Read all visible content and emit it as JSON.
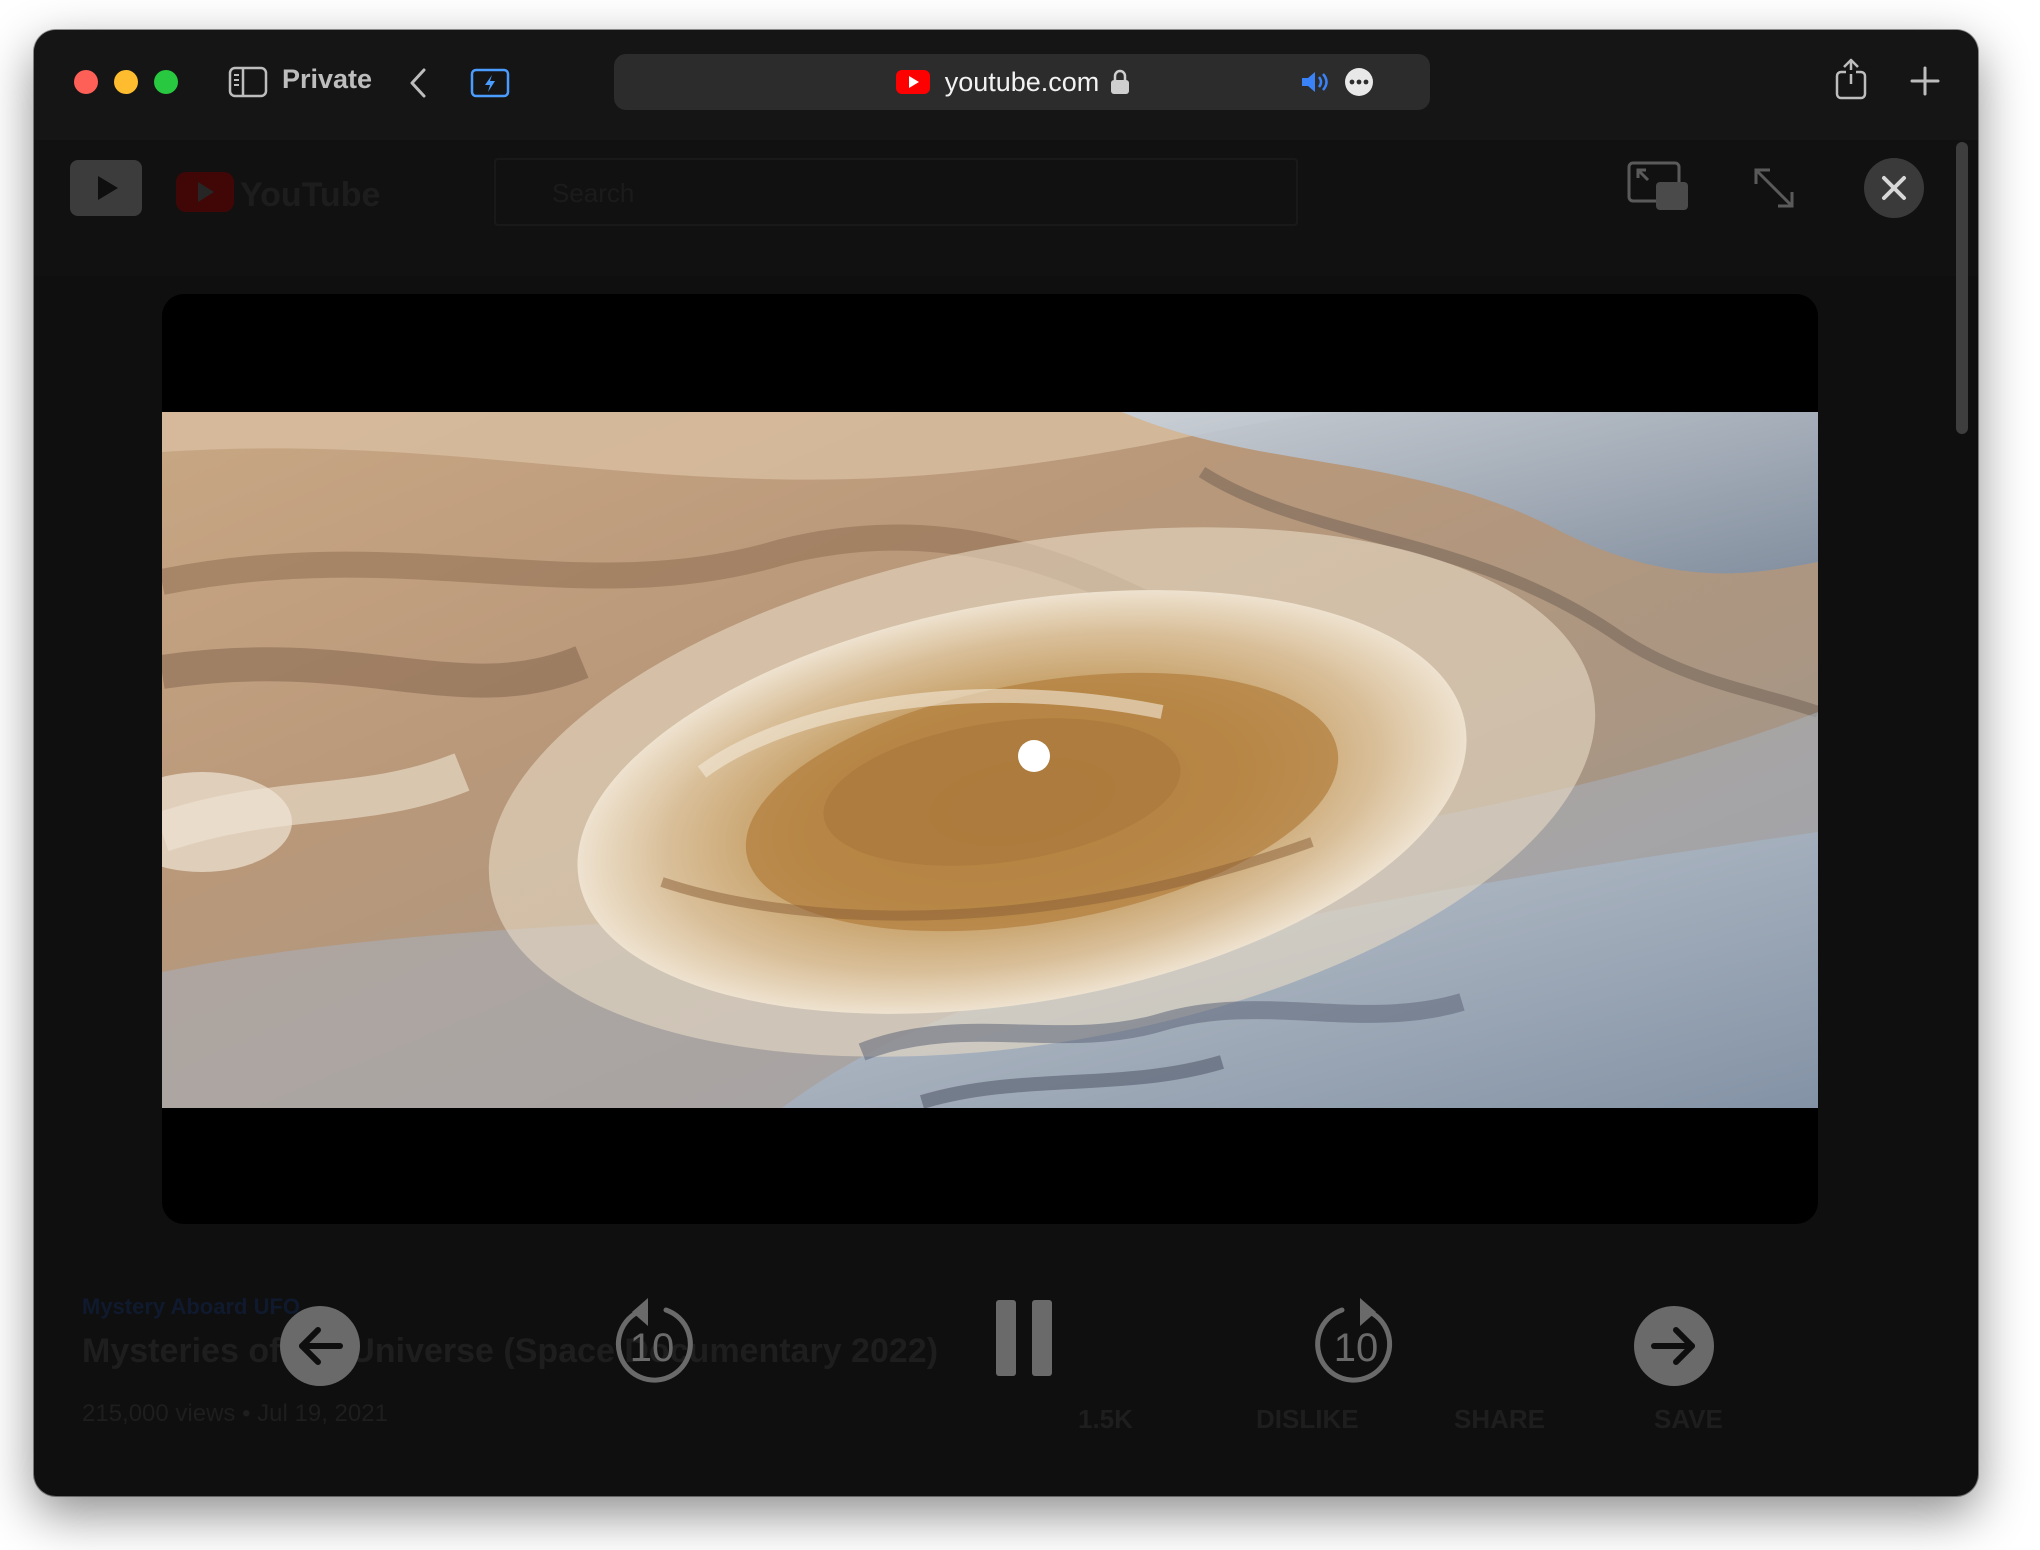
{
  "browser": {
    "private_label": "Private",
    "url": "youtube.com"
  },
  "youtube_bar": {
    "logo_text": "YouTube",
    "search_placeholder": "Search"
  },
  "video": {
    "channel": "Mystery Aboard UFO",
    "title": "Mysteries of the Universe (Space Documentary 2022)",
    "views_date": "215,000 views • Jul 19, 2021",
    "likes": "1.5K",
    "dislike_label": "DISLIKE",
    "share_label": "SHARE",
    "save_label": "SAVE"
  },
  "controls": {
    "skip_back_seconds": "10",
    "skip_forward_seconds": "10"
  },
  "colors": {
    "youtube_red": "#ff0000",
    "volume_blue": "#3a82f7"
  }
}
